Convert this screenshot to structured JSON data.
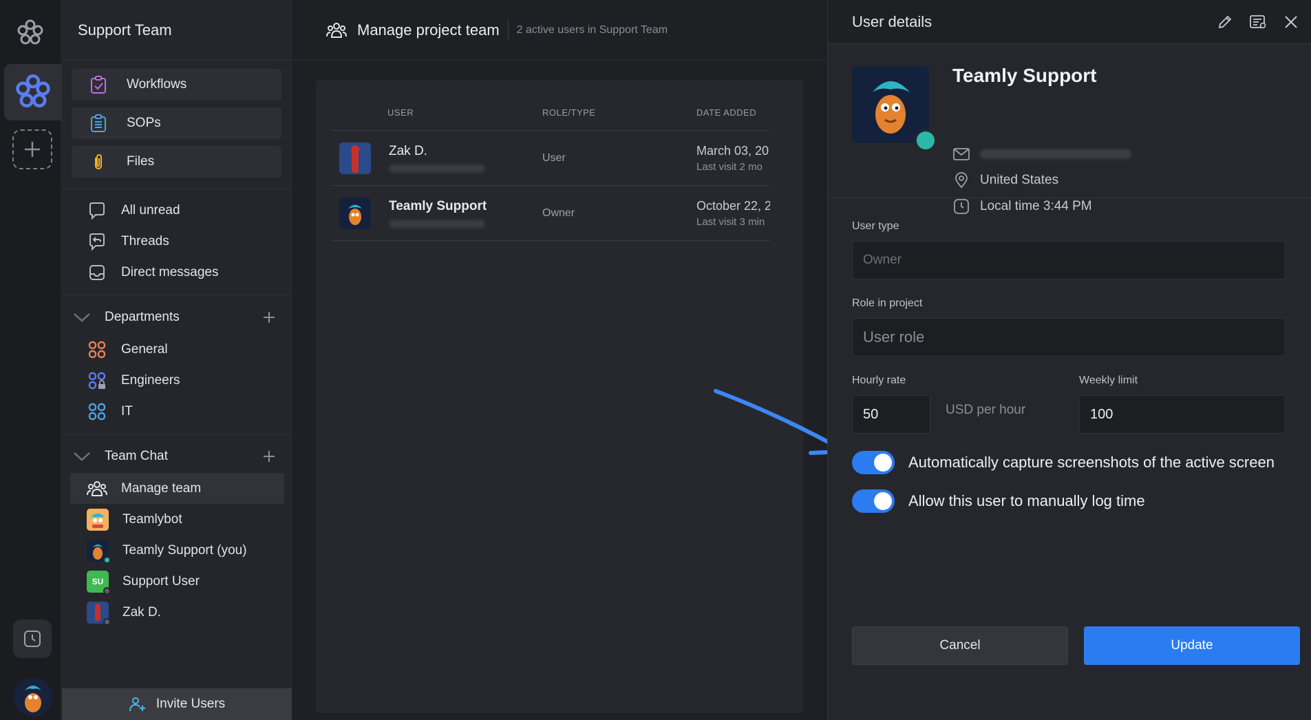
{
  "workspace": {
    "name": "Support Team"
  },
  "sidebar": {
    "tiles": [
      {
        "label": "Workflows",
        "icon": "clipboard-check-icon"
      },
      {
        "label": "SOPs",
        "icon": "checklist-icon"
      },
      {
        "label": "Files",
        "icon": "paperclip-icon"
      }
    ],
    "nav": [
      {
        "label": "All unread",
        "icon": "chat-bubble-icon"
      },
      {
        "label": "Threads",
        "icon": "thread-icon"
      },
      {
        "label": "Direct messages",
        "icon": "inbox-icon"
      }
    ],
    "departments": {
      "title": "Departments",
      "items": [
        {
          "label": "General",
          "color": "#e8825a"
        },
        {
          "label": "Engineers",
          "color": "#5b7cf0"
        },
        {
          "label": "IT",
          "color": "#4da3e0"
        }
      ]
    },
    "team_chat": {
      "title": "Team Chat",
      "items": [
        {
          "label": "Manage team",
          "icon": "team-icon"
        },
        {
          "label": "Teamlybot",
          "avatar": "bot"
        },
        {
          "label": "Teamly Support (you)",
          "avatar": "support"
        },
        {
          "label": "Support User",
          "avatar_text": "SU",
          "avatar_color": "#3fb950"
        },
        {
          "label": "Zak D.",
          "avatar": "zak"
        }
      ]
    },
    "invite_label": "Invite Users"
  },
  "main": {
    "title": "Manage project team",
    "subtitle": "2 active users in Support Team",
    "columns": [
      "USER",
      "ROLE/TYPE",
      "DATE ADDED"
    ],
    "rows": [
      {
        "name": "Zak D.",
        "role": "User",
        "date": "March 03, 20",
        "last_visit": "Last visit 2 mo"
      },
      {
        "name": "Teamly Support",
        "role": "Owner",
        "date": "October 22, 2",
        "last_visit": "Last visit 3 min"
      }
    ]
  },
  "details": {
    "title": "User details",
    "name": "Teamly Support",
    "location": "United States",
    "local_time": "Local time 3:44 PM",
    "user_type_label": "User type",
    "user_type_placeholder": "Owner",
    "role_label": "Role in project",
    "role_placeholder": "User role",
    "hourly_label": "Hourly rate",
    "hourly_value": "50",
    "hourly_unit": "USD per hour",
    "weekly_label": "Weekly limit",
    "weekly_value": "100",
    "toggle_screenshots": "Automatically capture screenshots of the active screen",
    "toggle_manual_time": "Allow this user to manually log time",
    "cancel_label": "Cancel",
    "update_label": "Update"
  },
  "colors": {
    "accent": "#2b7cf0",
    "online": "#2bb8a8"
  }
}
